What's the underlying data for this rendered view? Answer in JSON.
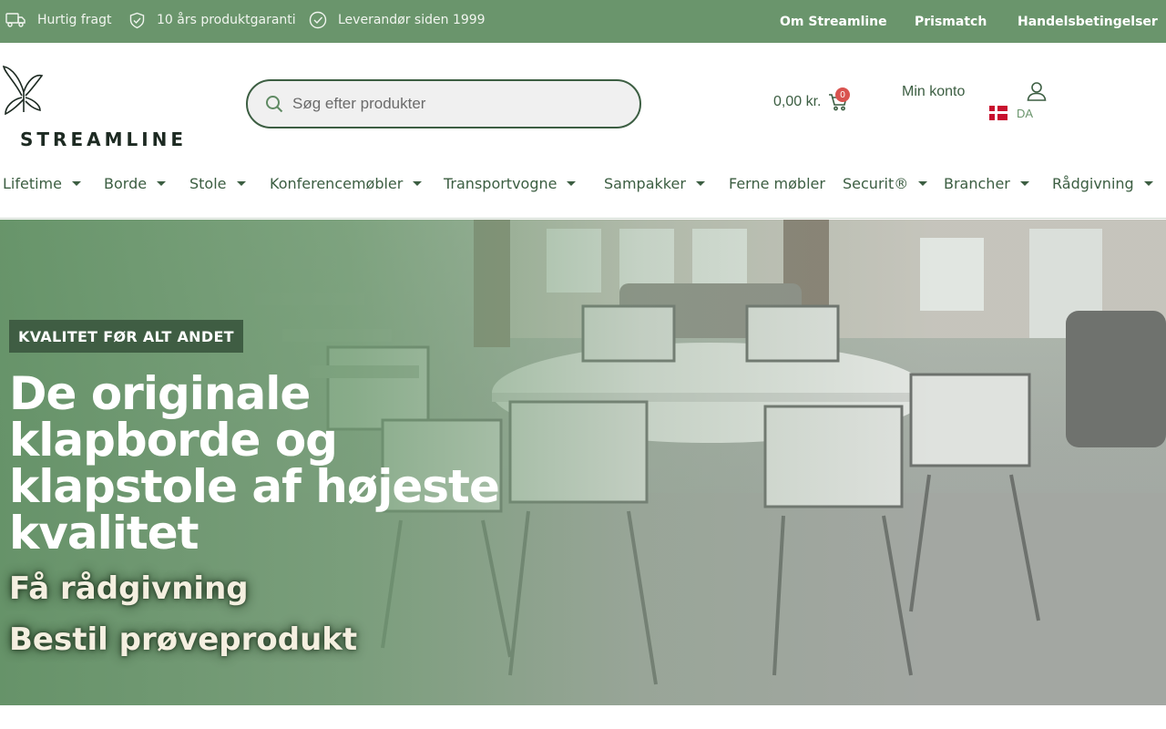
{
  "topbar": {
    "usps": [
      {
        "icon": "truck-icon",
        "label": "Hurtig fragt"
      },
      {
        "icon": "shield-check-icon",
        "label": "10 års produktgaranti"
      },
      {
        "icon": "check-circle-icon",
        "label": "Leverandør siden 1999"
      }
    ],
    "links": [
      "Om Streamline",
      "Prismatch",
      "Handelsbetingelser"
    ]
  },
  "header": {
    "logo_text": "STREAMLINE",
    "search_placeholder": "Søg efter produkter",
    "cart_total": "0,00 kr.",
    "cart_count": "0",
    "account_label": "Min konto",
    "language": "DA"
  },
  "nav": {
    "items": [
      {
        "label": "Lifetime",
        "dropdown": true
      },
      {
        "label": "Borde",
        "dropdown": true
      },
      {
        "label": "Stole",
        "dropdown": true
      },
      {
        "label": "Konferencemøbler",
        "dropdown": true
      },
      {
        "label": "Transportvogne",
        "dropdown": true
      },
      {
        "label": "Sampakker",
        "dropdown": true
      },
      {
        "label": "Ferne møbler",
        "dropdown": false
      },
      {
        "label": "Securit®",
        "dropdown": true
      },
      {
        "label": "Brancher",
        "dropdown": true
      },
      {
        "label": "Rådgivning",
        "dropdown": true
      }
    ]
  },
  "hero": {
    "tag": "KVALITET FØR ALT ANDET",
    "headline": "De originale klapborde og klapstole af højeste kvalitet",
    "cta_primary": "Få rådgivning",
    "cta_secondary": "Bestil prøveprodukt"
  },
  "colors": {
    "brand_green": "#6a956c",
    "dark_green": "#3c5e42",
    "badge_red": "#d9534f"
  }
}
